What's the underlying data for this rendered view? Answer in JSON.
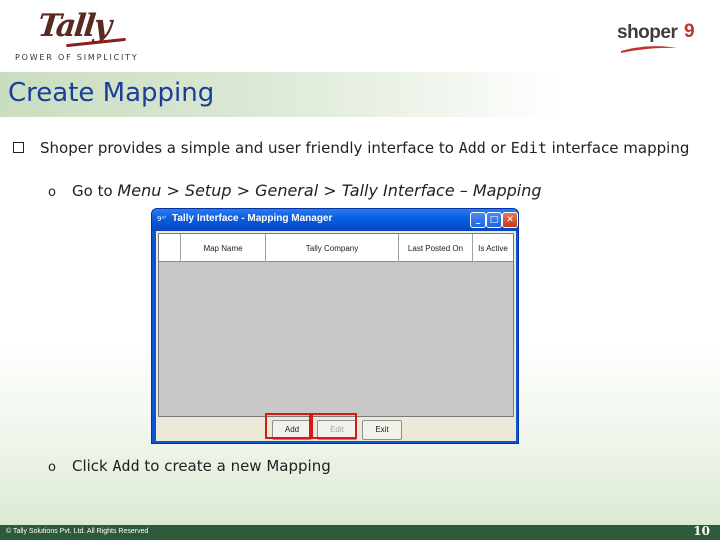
{
  "header": {
    "logo_text": "Tally",
    "tagline": "POWER OF SIMPLICITY",
    "product_logo": {
      "word": "shoper",
      "number": "9"
    }
  },
  "title": "Create Mapping",
  "bullets": {
    "main": "Shoper provides a simple and user friendly interface to",
    "add": "Add",
    "or": "or",
    "edit": "Edit",
    "rest": "interface mapping",
    "sub1_prefix": "Go to",
    "sub1_path": "Menu > Setup > General > Tally Interface – Mapping",
    "sub2_prefix": "Click",
    "sub2_add": "Add",
    "sub2_suffix": "to create a new Mapping"
  },
  "window": {
    "title": "Tally Interface - Mapping Manager",
    "icon_text": "9ᵒᶠ",
    "columns": [
      "",
      "Map Name",
      "Tally Company",
      "Last Posted On",
      "Is Active"
    ],
    "buttons": {
      "add": "Add",
      "edit": "Edit",
      "exit": "Exit"
    },
    "title_controls": {
      "minimize": "_",
      "maximize": "□",
      "close": "✕"
    }
  },
  "footer": {
    "copyright": "© Tally Solutions Pvt. Ltd. All Rights Reserved",
    "page": "10"
  },
  "colors": {
    "title_text": "#1a3f99",
    "highlight": "#d11a1a",
    "footer_bg": "#2e5a3c",
    "xp_blue": "#0a54d6"
  }
}
